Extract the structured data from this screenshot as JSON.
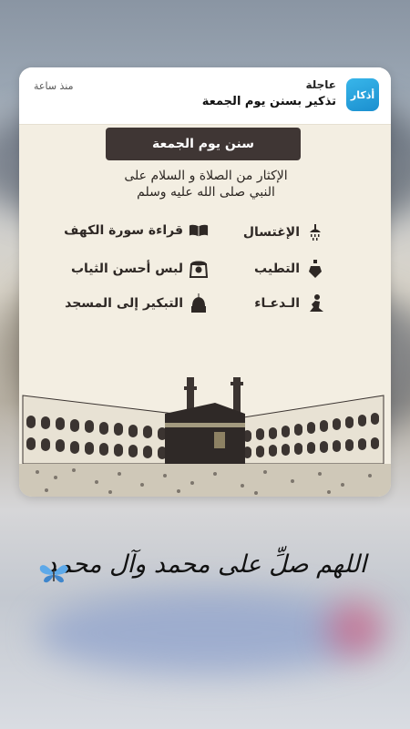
{
  "notification": {
    "app_name": "عاجلة",
    "app_icon_text": "أذكار",
    "title": "تذكير بسنن يوم الجمعة",
    "time": "منذ ساعة"
  },
  "card": {
    "banner": "سنن يوم الجمعة",
    "intro_line1": "الإكثار من الصلاة و السلام على",
    "intro_line2": "النبي صلى الله عليه وسلم",
    "sunnahs": [
      {
        "label": "الإغتسال",
        "icon": "shower-icon"
      },
      {
        "label": "قراءة سورة الكهف",
        "icon": "quran-book-icon"
      },
      {
        "label": "التطيب",
        "icon": "perfume-bottle-icon"
      },
      {
        "label": "لبس أحسن الثياب",
        "icon": "headdress-icon"
      },
      {
        "label": "الـدعـاء",
        "icon": "praying-person-icon"
      },
      {
        "label": "التبكير إلى المسجد",
        "icon": "mosque-icon"
      }
    ]
  },
  "caption": {
    "text": "اللهم صلِّ على محمد وآل محمد"
  },
  "colors": {
    "card_bg": "#f3eee2",
    "banner_bg": "#3f3634",
    "app_icon": "#2aa6e0"
  }
}
